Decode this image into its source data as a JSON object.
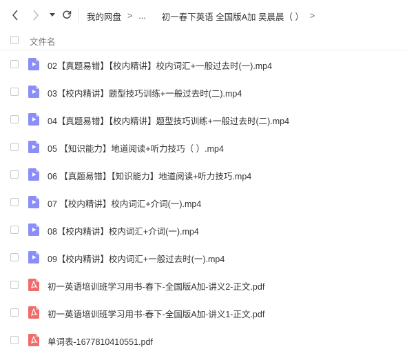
{
  "toolbar": {
    "back_icon": "chevron-left-icon",
    "forward_icon": "chevron-right-icon",
    "history_icon": "caret-down-icon",
    "refresh_icon": "refresh-icon"
  },
  "breadcrumb": {
    "root": "我的网盘",
    "ellipsis": "...",
    "current": "初一春下英语 全国版A加 吴晨晨（ ）",
    "sep1": ">",
    "sep2": ">",
    "sep3": ">"
  },
  "list": {
    "header_label": "文件名",
    "colors": {
      "video": "#8b8ef6",
      "pdf": "#f26b6b"
    },
    "files": [
      {
        "name": "02【真题易错】【校内精讲】校内词汇+一般过去时(一).mp4",
        "type": "video"
      },
      {
        "name": "03【校内精讲】题型技巧训练+一般过去时(二).mp4",
        "type": "video"
      },
      {
        "name": "04【真题易错】【校内精讲】题型技巧训练+一般过去时(二).mp4",
        "type": "video"
      },
      {
        "name": "05 【知识能力】地道阅读+听力技巧（ ）.mp4",
        "type": "video"
      },
      {
        "name": "06 【真题易错】【知识能力】地道阅读+听力技巧.mp4",
        "type": "video"
      },
      {
        "name": "07 【校内精讲】校内词汇+介词(一).mp4",
        "type": "video"
      },
      {
        "name": "08【校内精讲】校内词汇+介词(一).mp4",
        "type": "video"
      },
      {
        "name": "09【校内精讲】校内词汇+一般过去时(一).mp4",
        "type": "video"
      },
      {
        "name": "初一英语培训班学习用书-春下-全国版A加-讲义2-正文.pdf",
        "type": "pdf"
      },
      {
        "name": "初一英语培训班学习用书-春下-全国版A加-讲义1-正文.pdf",
        "type": "pdf"
      },
      {
        "name": "单词表-1677810410551.pdf",
        "type": "pdf"
      }
    ]
  }
}
